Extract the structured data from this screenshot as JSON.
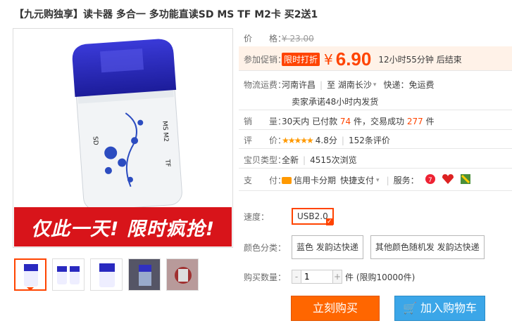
{
  "title": "【九元购独享】读卡器 多合一 多功能直读SD MS TF M2卡 买2送1",
  "banner_text": "仅此一天! 限时疯抢!",
  "colors": {
    "accent": "#ff4400",
    "cart": "#3ba6e8",
    "banner": "#d8141a"
  },
  "price": {
    "label": "价　　格：",
    "value": "¥ 23.00"
  },
  "promo": {
    "label": "参加促销：",
    "badge": "限时打折",
    "yen": "¥",
    "value": "6.90",
    "countdown": "12小时55分钟 后结束"
  },
  "shipping": {
    "label": "物流运费：",
    "from": "河南许昌",
    "to_prefix": "至",
    "to": "湖南长沙",
    "express": "快递：免运费",
    "promise": "卖家承诺48小时内发货"
  },
  "sales": {
    "label": "销　　量：",
    "prefix": "30天内 已付款",
    "paid": "74",
    "unit1": "件，交易成功",
    "success": "277",
    "unit2": "件"
  },
  "rating": {
    "label": "评　　价：",
    "stars": "★★★★★",
    "score": "4.8分",
    "reviews": "152条评价"
  },
  "type": {
    "label": "宝贝类型：",
    "value": "全新",
    "views": "4515次浏览"
  },
  "payment": {
    "label": "支　　付：",
    "credit": "信用卡分期",
    "fast": "快捷支付",
    "service_label": "服务：",
    "icons": [
      "seven-day-return-icon",
      "guarantee-icon",
      "quality-icon"
    ]
  },
  "speed": {
    "label": "速度：",
    "options": [
      "USB2.0"
    ]
  },
  "color": {
    "label": "颜色分类：",
    "options": [
      "蓝色 发韵达快递",
      "其他颜色随机发 发韵达快递"
    ]
  },
  "quantity": {
    "label": "购买数量：",
    "value": "1",
    "minus": "-",
    "plus": "+",
    "stock": "件 (限购10000件)"
  },
  "buttons": {
    "buy": "立刻购买",
    "cart": "加入购物车",
    "cart_icon": "cart-icon"
  },
  "thumbnails": [
    "thumb-reader-front",
    "thumb-reader-pair",
    "thumb-reader-blue",
    "thumb-reader-photo",
    "thumb-reader-package"
  ]
}
